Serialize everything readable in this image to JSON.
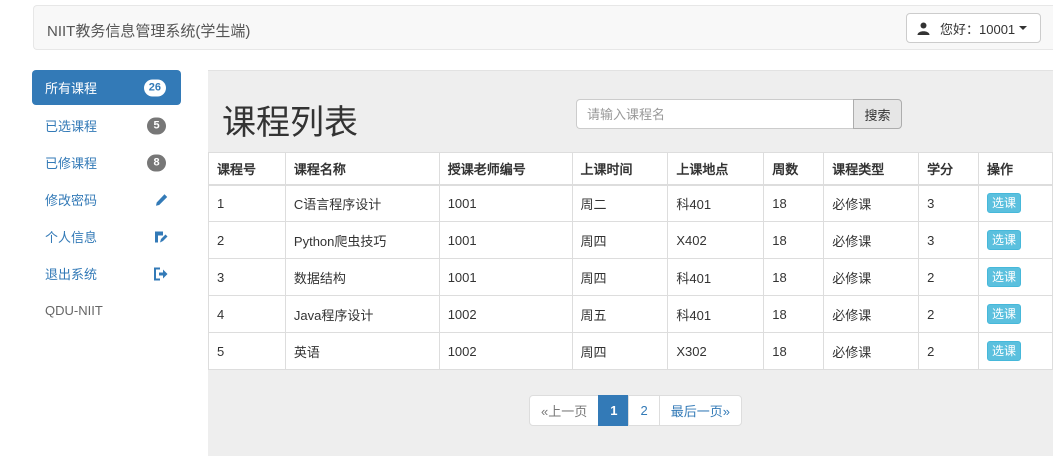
{
  "header": {
    "brand": "NIIT教务信息管理系统(学生端)",
    "user_label": "您好：10001"
  },
  "sidebar": {
    "items": [
      {
        "label": "所有课程",
        "badge": "26"
      },
      {
        "label": "已选课程",
        "badge": "5"
      },
      {
        "label": "已修课程",
        "badge": "8"
      },
      {
        "label": "修改密码",
        "icon": "pencil-icon"
      },
      {
        "label": "个人信息",
        "icon": "user-edit-icon"
      },
      {
        "label": "退出系统",
        "icon": "logout-icon"
      },
      {
        "label": "QDU-NIIT"
      }
    ]
  },
  "main": {
    "title": "课程列表",
    "search_placeholder": "请输入课程名",
    "search_label": "搜索",
    "columns": [
      "课程号",
      "课程名称",
      "授课老师编号",
      "上课时间",
      "上课地点",
      "周数",
      "课程类型",
      "学分",
      "操作"
    ],
    "rows": [
      [
        "1",
        "C语言程序设计",
        "1001",
        "周二",
        "科401",
        "18",
        "必修课",
        "3"
      ],
      [
        "2",
        "Python爬虫技巧",
        "1001",
        "周四",
        "X402",
        "18",
        "必修课",
        "3"
      ],
      [
        "3",
        "数据结构",
        "1001",
        "周四",
        "科401",
        "18",
        "必修课",
        "2"
      ],
      [
        "4",
        "Java程序设计",
        "1002",
        "周五",
        "科401",
        "18",
        "必修课",
        "2"
      ],
      [
        "5",
        "英语",
        "1002",
        "周四",
        "X302",
        "18",
        "必修课",
        "2"
      ]
    ],
    "action_label": "选课"
  },
  "pagination": {
    "prev": "«上一页",
    "pages": [
      "1",
      "2"
    ],
    "last": "最后一页»"
  },
  "colors": {
    "primary": "#337ab7",
    "info_button": "#5bc0de"
  }
}
